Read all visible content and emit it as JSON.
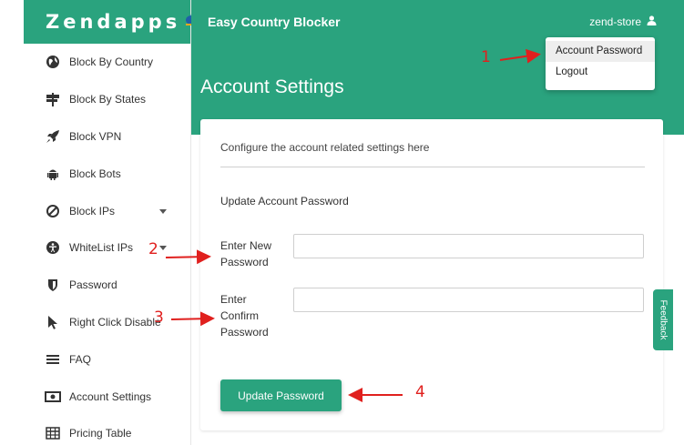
{
  "brand": {
    "logo_text": "Zendapps"
  },
  "topbar": {
    "app_title": "Easy Country Blocker",
    "user_name": "zend-store"
  },
  "sidebar": {
    "items": [
      {
        "label": "Block By Country",
        "icon": "globe-icon"
      },
      {
        "label": "Block By States",
        "icon": "signpost-icon"
      },
      {
        "label": "Block VPN",
        "icon": "rocket-icon"
      },
      {
        "label": "Block Bots",
        "icon": "android-icon"
      },
      {
        "label": "Block IPs",
        "icon": "ban-icon"
      },
      {
        "label": "WhiteList IPs",
        "icon": "accessibility-icon"
      },
      {
        "label": "Password",
        "icon": "shield-icon"
      },
      {
        "label": "Right Click Disable",
        "icon": "cursor-icon"
      },
      {
        "label": "FAQ",
        "icon": "bars-icon"
      },
      {
        "label": "Account Settings",
        "icon": "money-icon"
      },
      {
        "label": "Pricing Table",
        "icon": "table-icon"
      }
    ]
  },
  "page": {
    "title": "Account Settings"
  },
  "dropdown": {
    "items": [
      "Account Password",
      "Logout"
    ]
  },
  "card": {
    "description": "Configure the account related settings here",
    "section_title": "Update Account Password",
    "new_password_label_1": "Enter New",
    "new_password_label_2": "Password",
    "confirm_label_1": "Enter",
    "confirm_label_2": "Confirm",
    "confirm_label_3": "Password",
    "new_password_value": "",
    "confirm_password_value": "",
    "submit_label": "Update Password"
  },
  "feedback_label": "Feedback",
  "annotations": [
    "1",
    "2",
    "3",
    "4"
  ],
  "colors": {
    "brand": "#2aa37e",
    "annotation": "#e0201e"
  }
}
